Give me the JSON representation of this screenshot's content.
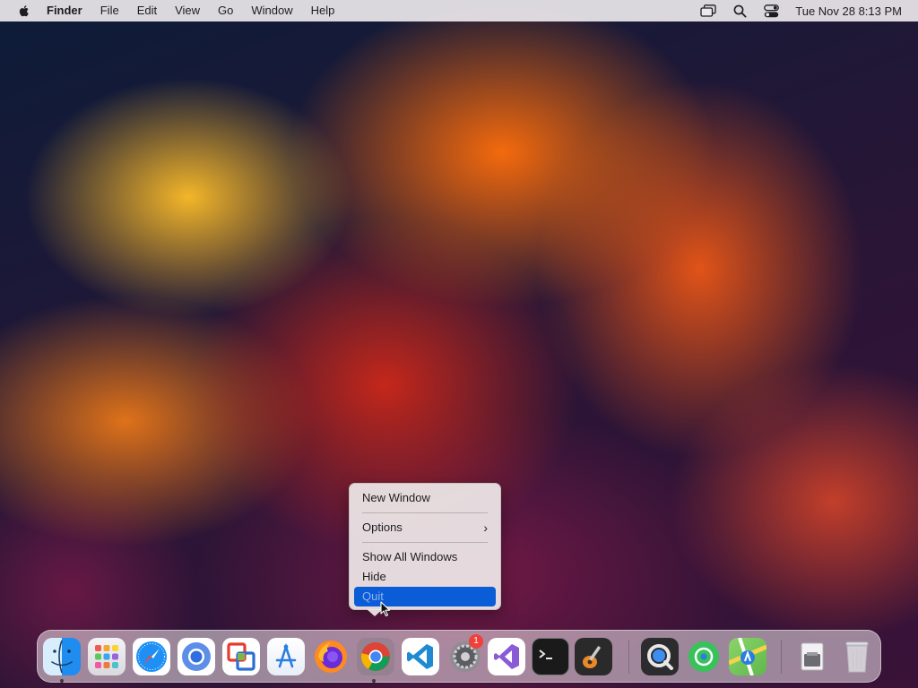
{
  "menubar": {
    "app_name": "Finder",
    "items": [
      "File",
      "Edit",
      "View",
      "Go",
      "Window",
      "Help"
    ],
    "status_icons": [
      "window-stack-icon",
      "search-icon",
      "control-center-icon"
    ],
    "clock": "Tue Nov 28  8:13 PM"
  },
  "context_menu": {
    "items": [
      {
        "label": "New Window"
      },
      {
        "label": "Options",
        "submenu": true
      },
      {
        "label": "Show All Windows"
      },
      {
        "label": "Hide"
      },
      {
        "label": "Quit",
        "highlighted": true
      }
    ],
    "highlight_color": "#0b5cd7"
  },
  "dock": {
    "apps": [
      {
        "icon": "finder-icon",
        "running": true
      },
      {
        "icon": "launchpad-icon"
      },
      {
        "icon": "safari-icon"
      },
      {
        "icon": "chromium-icon"
      },
      {
        "icon": "vmware-fusion-icon"
      },
      {
        "icon": "app-store-icon"
      },
      {
        "icon": "firefox-icon"
      },
      {
        "icon": "chrome-icon",
        "running": true
      },
      {
        "icon": "vscode-icon"
      },
      {
        "icon": "system-settings-icon",
        "badge": "1"
      },
      {
        "icon": "visual-studio-icon"
      },
      {
        "icon": "terminal-icon"
      },
      {
        "icon": "garageband-icon"
      },
      {
        "icon": "quicktime-icon"
      },
      {
        "icon": "find-my-icon"
      },
      {
        "icon": "maps-icon"
      },
      {
        "icon": "downloads-folder-icon"
      },
      {
        "icon": "trash-icon"
      }
    ]
  }
}
